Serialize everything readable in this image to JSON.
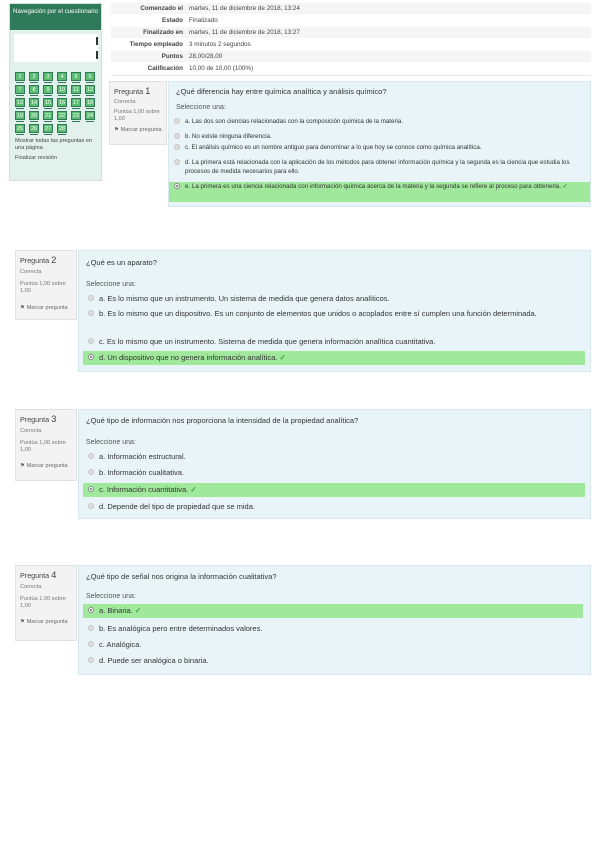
{
  "nav": {
    "title": "Navegación por el cuestionario",
    "question_numbers": [
      "1",
      "2",
      "3",
      "4",
      "5",
      "6",
      "7",
      "8",
      "9",
      "10",
      "11",
      "12",
      "13",
      "14",
      "15",
      "16",
      "17",
      "18",
      "19",
      "20",
      "21",
      "22",
      "23",
      "24",
      "25",
      "26",
      "27",
      "28"
    ],
    "show_all_label": "Mostrar todas las preguntas en una página",
    "finish_review_label": "Finalizar revisión"
  },
  "summary": [
    {
      "label": "Comenzado el",
      "value": "martes, 11 de diciembre de 2018, 13:24"
    },
    {
      "label": "Estado",
      "value": "Finalizado"
    },
    {
      "label": "Finalizado en",
      "value": "martes, 11 de diciembre de 2018, 13:27"
    },
    {
      "label": "Tiempo empleado",
      "value": "3 minutos 2 segundos"
    },
    {
      "label": "Puntos",
      "value": "28,00/28,00"
    },
    {
      "label": "Calificación",
      "value": "10,00 de 10,00 (100%)"
    }
  ],
  "questions": [
    {
      "label": "Pregunta",
      "number": "1",
      "state": "Correcta",
      "grade": "Puntúa 1,00 sobre 1,00",
      "flag": "Marcar pregunta",
      "text": "¿Qué diferencia hay entre química analítica y análisis químico?",
      "prompt": "Seleccione una:",
      "answers": [
        "a. Las dos son ciencias relacionadas con la composición química de la materia.",
        "b. No existe ninguna diferencia.",
        "c. El análisis químico es un nombre antiguo para denominar a lo que hoy se conoce como química analítica.",
        "d. La primera está relacionada con la aplicación de los métodos para obtener información química y la segunda es la ciencia que estudia los procesos de medida necesarios para ello.",
        "e. La primera es una ciencia relacionada con información química acerca de la materia y la segunda se refiere al proceso para obtenerla."
      ],
      "check": "✓"
    },
    {
      "label": "Pregunta",
      "number": "2",
      "state": "Correcta",
      "grade": "Puntúa 1,00 sobre 1,00",
      "flag": "Marcar pregunta",
      "text": "¿Qué es un aparato?",
      "prompt": "Seleccione una:",
      "answers": [
        "a. Es lo mismo que un instrumento. Un sistema de medida que genera datos analíticos.",
        "b. Es lo mismo que un dispositivo. Es un conjunto de elementos que unidos o acoplados entre sí cumplen una función determinada.",
        "c. Es lo mismo que un instrumento. Sistema de medida que genera información analítica cuantitativa.",
        "d. Un dispositivo que no genera información analítica."
      ],
      "check": "✓"
    },
    {
      "label": "Pregunta",
      "number": "3",
      "state": "Correcta",
      "grade": "Puntúa 1,00 sobre 1,00",
      "flag": "Marcar pregunta",
      "text": "¿Qué tipo de información nos proporciona la intensidad de la propiedad analítica?",
      "prompt": "Seleccione una:",
      "answers": [
        "a. Información estructural.",
        "b. Información cualitativa.",
        "c. Información cuantitativa.",
        "d. Depende del tipo de propiedad que se mida."
      ],
      "check": "✓"
    },
    {
      "label": "Pregunta",
      "number": "4",
      "state": "Correcta",
      "grade": "Puntúa 1,00 sobre 1,00",
      "flag": "Marcar pregunta",
      "text": "¿Qué tipo de señal nos origina la información cualitativa?",
      "prompt": "Seleccione una:",
      "answers": [
        "a. Binaria.",
        "b. Es analógica pero entre determinados valores.",
        "c. Analógica.",
        "d. Puede ser analógica o binaria."
      ],
      "check": "✓"
    }
  ]
}
